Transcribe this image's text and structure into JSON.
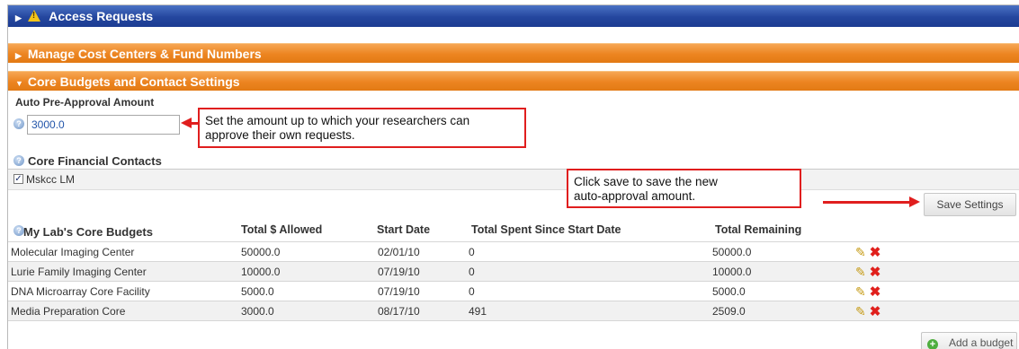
{
  "sections": {
    "access_requests": "Access Requests",
    "manage_cost_centers": "Manage Cost Centers & Fund Numbers",
    "core_budgets": "Core Budgets and Contact Settings"
  },
  "auto_approval": {
    "label": "Auto Pre-Approval Amount",
    "value": "3000.0"
  },
  "callouts": {
    "amount_line1": "Set the amount up to which your researchers can",
    "amount_line2": "approve their own requests.",
    "save_line1": "Click save to save the new",
    "save_line2": "auto-approval amount."
  },
  "contacts": {
    "label": "Core Financial Contacts",
    "items": [
      {
        "name": "Mskcc LM",
        "checked": true
      }
    ]
  },
  "buttons": {
    "save": "Save Settings",
    "add_budget": "Add a budget"
  },
  "budgets": {
    "headers": [
      "My Lab's Core Budgets",
      "Total $ Allowed",
      "Start Date",
      "Total Spent Since Start Date",
      "Total Remaining"
    ],
    "rows": [
      [
        "Molecular Imaging Center",
        "50000.0",
        "02/01/10",
        "0",
        "50000.0"
      ],
      [
        "Lurie Family Imaging Center",
        "10000.0",
        "07/19/10",
        "0",
        "10000.0"
      ],
      [
        "DNA Microarray Core Facility",
        "5000.0",
        "07/19/10",
        "0",
        "5000.0"
      ],
      [
        "Media Preparation Core",
        "3000.0",
        "08/17/10",
        "491",
        "2509.0"
      ]
    ]
  },
  "icons": {
    "collapsed": "triangle-right-icon",
    "expanded": "triangle-down-icon",
    "warning": "warning-icon",
    "help": "help-icon",
    "edit": "pencil-icon",
    "delete": "delete-x-icon",
    "add": "plus-circle-icon"
  },
  "colors": {
    "blue_bar": "#2a4ea6",
    "orange_bar": "#ec8420",
    "callout_red": "#e01e1e"
  }
}
